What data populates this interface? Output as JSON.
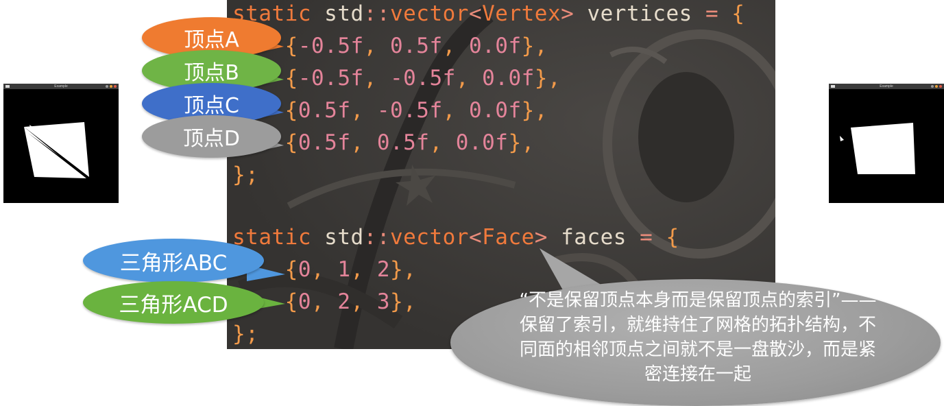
{
  "code": {
    "vertices_decl": {
      "kw": "static",
      "ns": "std",
      "sep": "::",
      "type": "vector",
      "lt": "<",
      "arg": "Vertex",
      "gt": ">",
      "name": "vertices",
      "eq": "=",
      "brace": "{"
    },
    "vertex_rows": [
      [
        "-0.5f",
        "0.5f",
        "0.0f"
      ],
      [
        "-0.5f",
        "-0.5f",
        "0.0f"
      ],
      [
        "0.5f",
        "-0.5f",
        "0.0f"
      ],
      [
        "0.5f",
        "0.5f",
        "0.0f"
      ]
    ],
    "faces_decl": {
      "kw": "static",
      "ns": "std",
      "sep": "::",
      "type": "vector",
      "lt": "<",
      "arg": "Face",
      "gt": ">",
      "name": "faces",
      "eq": "=",
      "brace": "{"
    },
    "face_rows": [
      [
        "0",
        "1",
        "2"
      ],
      [
        "0",
        "2",
        "3"
      ]
    ],
    "close": "};",
    "row_open": "{",
    "row_close_comma": "},",
    "comma": ", "
  },
  "labels": {
    "vertex_a": "顶点A",
    "vertex_b": "顶点B",
    "vertex_c": "顶点C",
    "vertex_d": "顶点D",
    "triangle_abc": "三角形ABC",
    "triangle_acd": "三角形ACD"
  },
  "quote": "“不是保留顶点本身而是保留顶点的索引”——保留了索引，就维持住了网格的拓扑结构，不同面的相邻顶点之间就不是一盘散沙，而是紧密连接在一起",
  "mini_windows": {
    "left_title": "Example",
    "right_title": "Example"
  },
  "colors": {
    "code_bg": "#3c3a38",
    "bubble_orange": "#ef7b30",
    "bubble_green": "#6fb446",
    "bubble_blue": "#3f6fc9",
    "bubble_gray": "#9c9c9c",
    "bubble_lightblue": "#4f97de",
    "bubble_green2": "#6ab33f"
  }
}
